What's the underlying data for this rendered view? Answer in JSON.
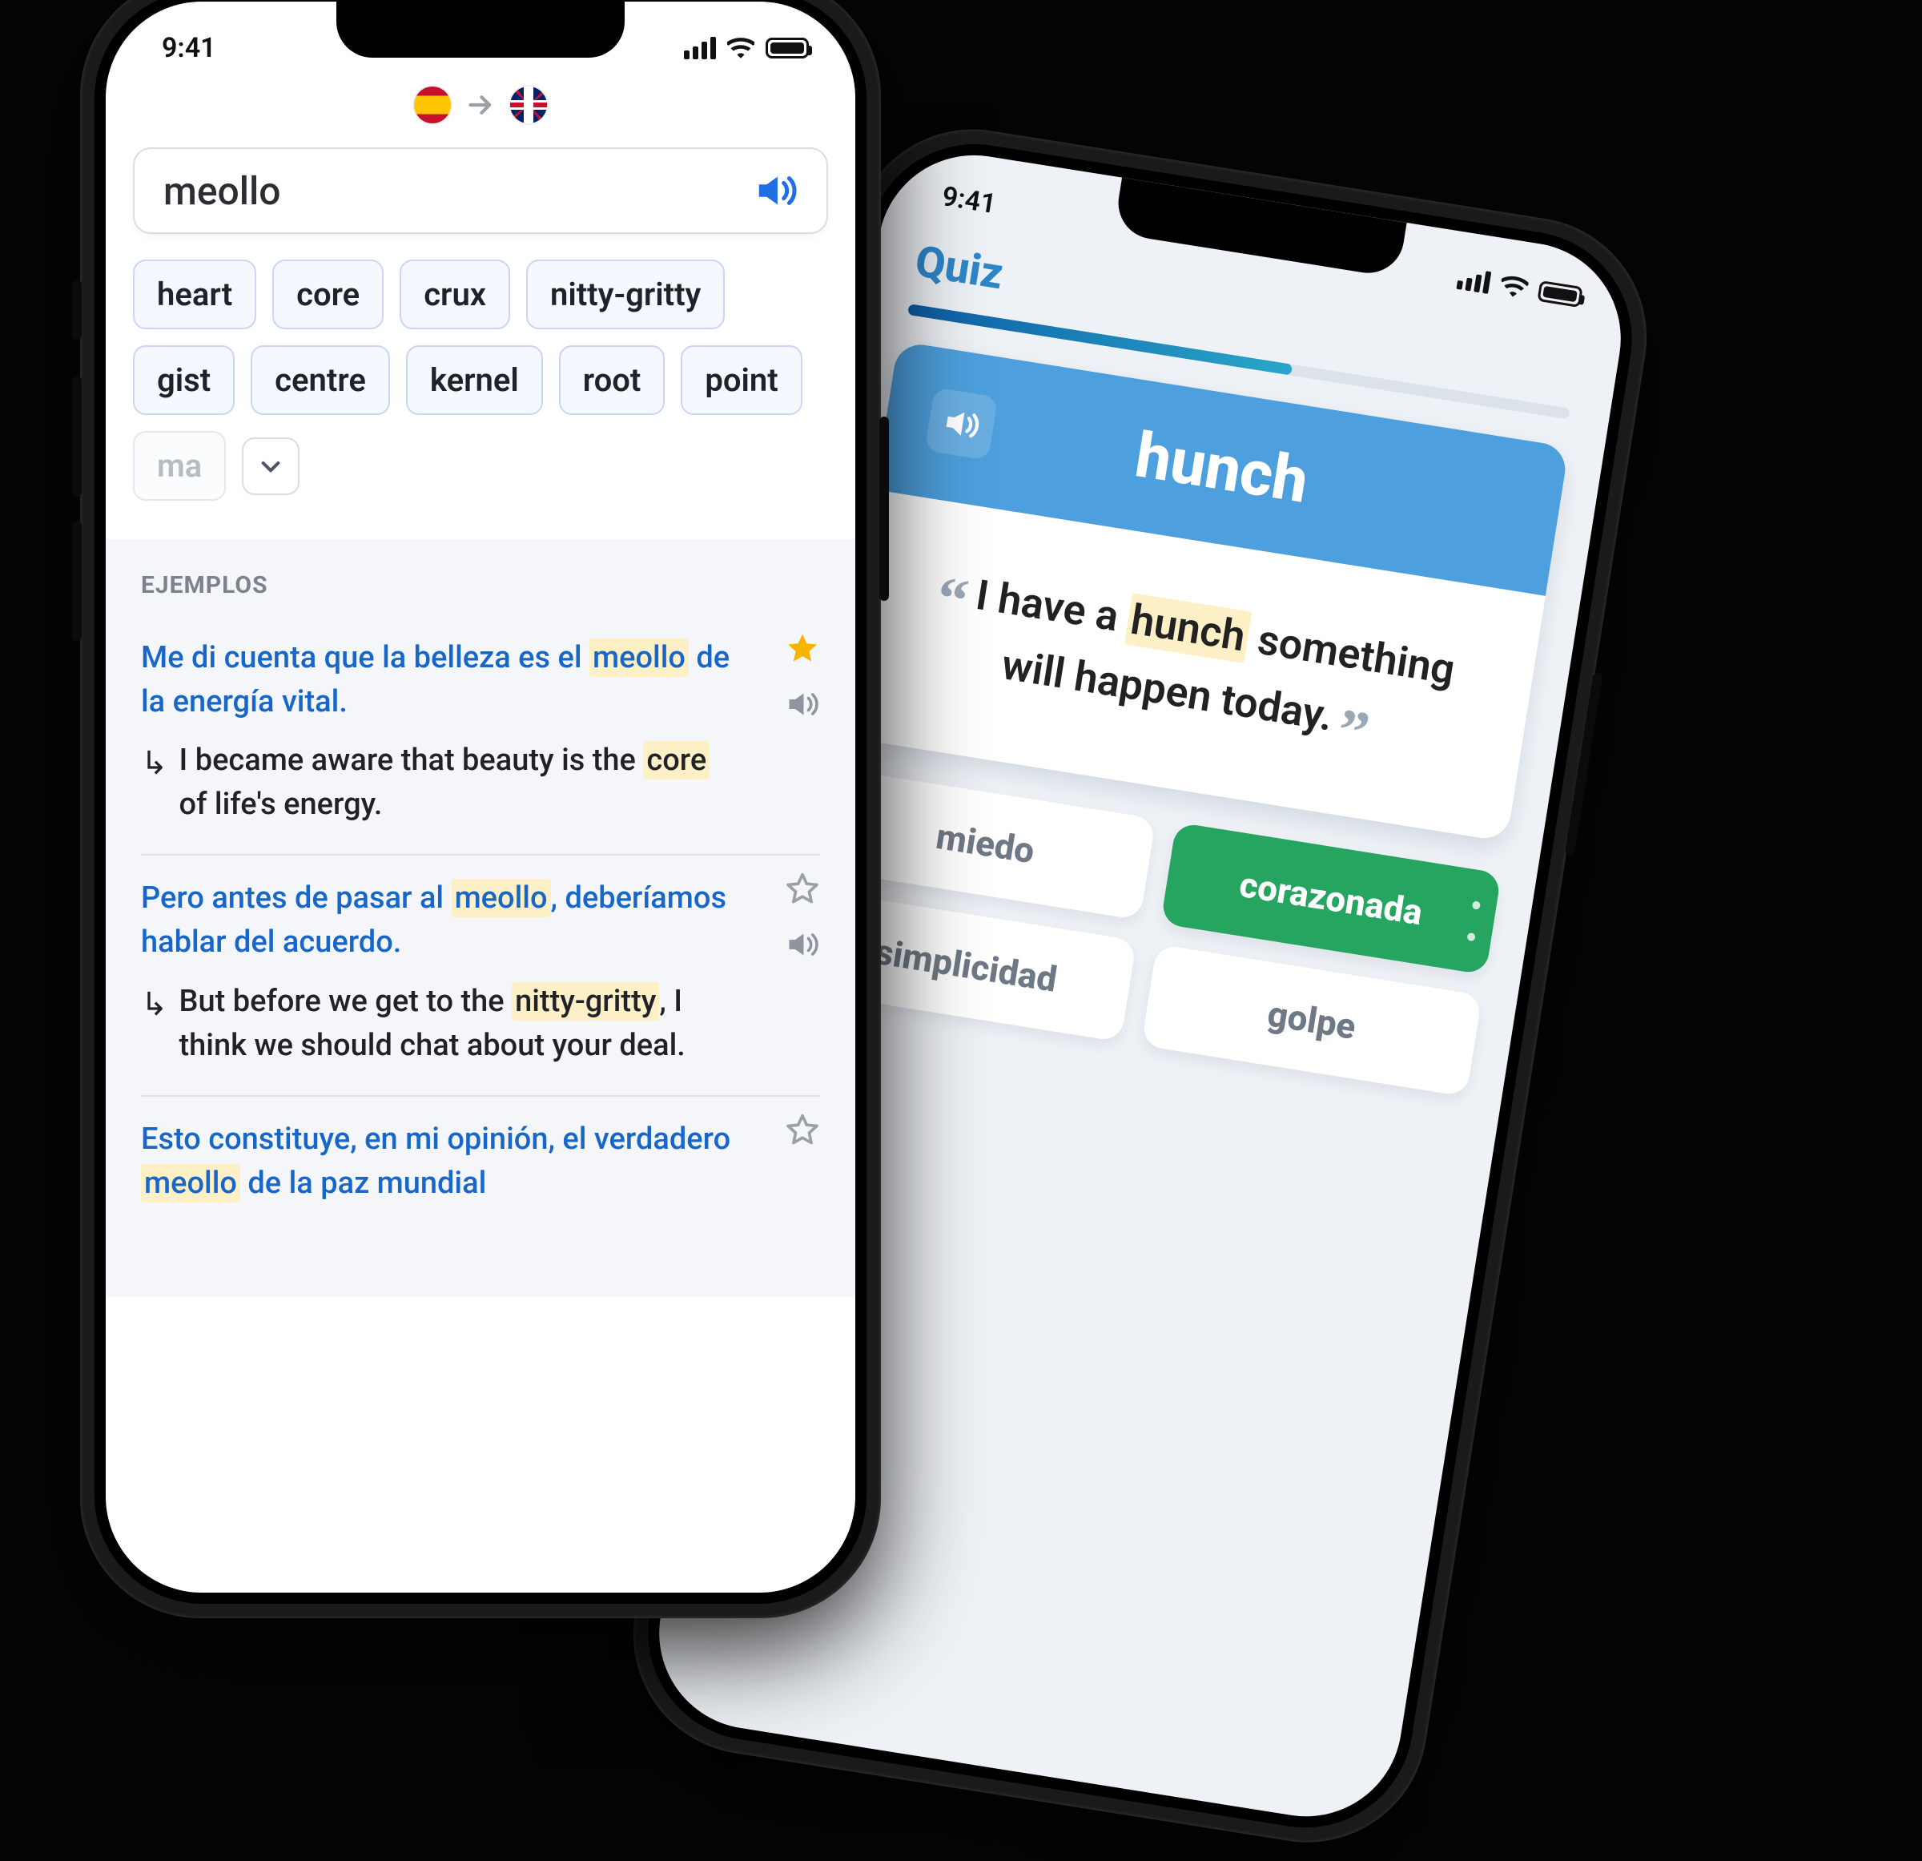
{
  "status": {
    "time": "9:41"
  },
  "phone1": {
    "from_lang": "es",
    "to_lang": "en-gb",
    "search_term": "meollo",
    "chips_row1": [
      "heart",
      "core",
      "crux",
      "nitty-gritty",
      "gist"
    ],
    "chips_row2": [
      "centre",
      "kernel",
      "root",
      "point"
    ],
    "chip_overflow": "ma",
    "section_title": "EJEMPLOS",
    "examples": [
      {
        "src_pre": "Me di cuenta que la belleza es el ",
        "src_hl": "meollo",
        "src_post": " de la energía vital.",
        "tgt_pre": "I became aware that beauty is the ",
        "tgt_hl": "core",
        "tgt_post": " of life's energy.",
        "starred": true
      },
      {
        "src_pre": "Pero antes de pasar al ",
        "src_hl": "meollo",
        "src_post": ", deberíamos hablar del acuerdo.",
        "tgt_pre": "But before we get to the ",
        "tgt_hl": "nitty-gritty",
        "tgt_post": ", I think we should chat about your deal.",
        "starred": false
      },
      {
        "src_pre": "Esto constituye, en mi opinión, el verdadero ",
        "src_hl": "meollo",
        "src_post": " de la paz mundial",
        "tgt_pre": "",
        "tgt_hl": "",
        "tgt_post": "",
        "starred": false
      }
    ]
  },
  "phone2": {
    "title": "Quiz",
    "progress_pct": 58,
    "word": "hunch",
    "sentence_pre": "I have a ",
    "sentence_hl": "hunch",
    "sentence_post": " something will happen today.",
    "answers": [
      {
        "label": "miedo",
        "correct": false
      },
      {
        "label": "corazonada",
        "correct": true
      },
      {
        "label": "simplicidad",
        "correct": false
      },
      {
        "label": "golpe",
        "correct": false
      }
    ]
  }
}
